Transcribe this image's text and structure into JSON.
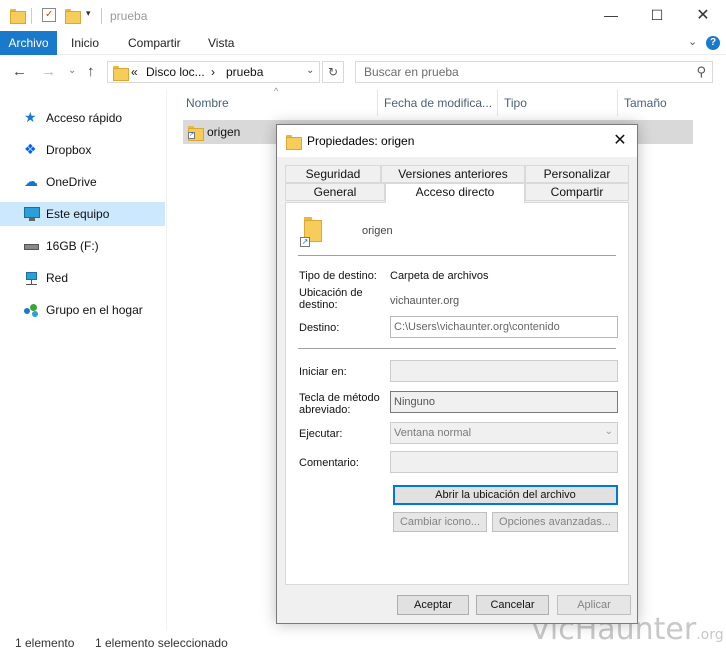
{
  "titlebar": {
    "path": "prueba"
  },
  "ribbon": {
    "tabs": [
      "Archivo",
      "Inicio",
      "Compartir",
      "Vista"
    ],
    "help": "?"
  },
  "address": {
    "parts": [
      "«",
      "Disco loc...",
      "›",
      "prueba"
    ],
    "search_placeholder": "Buscar en prueba"
  },
  "nav": {
    "items": [
      {
        "label": "Acceso rápido",
        "icon": "star-icon",
        "color": "#1979ca"
      },
      {
        "label": "Dropbox",
        "icon": "dropbox-icon",
        "color": "#0061fe"
      },
      {
        "label": "OneDrive",
        "icon": "cloud-icon",
        "color": "#0f78d4"
      },
      {
        "label": "Este equipo",
        "icon": "computer-icon",
        "color": "#2a9fd8",
        "selected": true
      },
      {
        "label": "16GB (F:)",
        "icon": "drive-icon",
        "color": "#777777"
      },
      {
        "label": "Red",
        "icon": "network-icon",
        "color": "#2a9fd8"
      },
      {
        "label": "Grupo en el hogar",
        "icon": "homegroup-icon",
        "color": "#3aa63a"
      }
    ]
  },
  "filelist": {
    "columns": [
      "Nombre",
      "Fecha de modifica...",
      "Tipo",
      "Tamaño"
    ],
    "rows": [
      {
        "name": "origen"
      }
    ]
  },
  "status": {
    "count": "1 elemento",
    "selected": "1 elemento seleccionado"
  },
  "watermark": {
    "text": "VicHaunter",
    "suffix": ".org"
  },
  "dialog": {
    "title": "Propiedades: origen",
    "close": "✕",
    "tabs_row1": [
      "Seguridad",
      "Versiones anteriores",
      "Personalizar"
    ],
    "tabs_row2": [
      "General",
      "Acceso directo",
      "Compartir"
    ],
    "active_tab": "Acceso directo",
    "name": "origen",
    "fields": {
      "tipo_destino_label": "Tipo de destino:",
      "tipo_destino_value": "Carpeta de archivos",
      "ubicacion_label": "Ubicación de destino:",
      "ubicacion_value": "vichaunter.org",
      "destino_label": "Destino:",
      "destino_value": "C:\\Users\\vichaunter.org\\contenido",
      "iniciar_label": "Iniciar en:",
      "iniciar_value": "",
      "tecla_label": "Tecla de método abreviado:",
      "tecla_value": "Ninguno",
      "ejecutar_label": "Ejecutar:",
      "ejecutar_value": "Ventana normal",
      "comentario_label": "Comentario:",
      "comentario_value": ""
    },
    "buttons": {
      "open_location": "Abrir la ubicación del archivo",
      "change_icon": "Cambiar icono...",
      "advanced": "Opciones avanzadas...",
      "ok": "Aceptar",
      "cancel": "Cancelar",
      "apply": "Aplicar"
    }
  },
  "colors": {
    "accent": "#1979ca",
    "selection": "#cce8ff",
    "folder": "#f6cc5b"
  }
}
